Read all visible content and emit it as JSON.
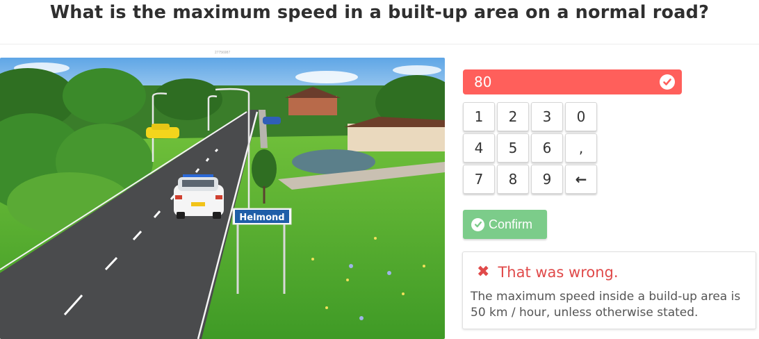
{
  "question": {
    "title": "What is the maximum speed in a built-up area on a normal road?"
  },
  "image": {
    "caption": "27756987",
    "sign_text": "Helmond"
  },
  "answer": {
    "value": "80",
    "status_icon": "check-circle-icon"
  },
  "keypad": {
    "keys": [
      "1",
      "2",
      "3",
      "0",
      "4",
      "5",
      "6",
      ",",
      "7",
      "8",
      "9",
      "←"
    ]
  },
  "confirm": {
    "label": "Confirm",
    "icon": "check-circle-icon"
  },
  "feedback": {
    "title": "That was wrong.",
    "icon": "x-icon",
    "text": "The maximum speed inside a build-up area is 50 km / hour, unless otherwise stated."
  },
  "colors": {
    "error": "#ff5f5b",
    "error_text": "#e04a4a",
    "confirm": "#7ccc8a"
  }
}
